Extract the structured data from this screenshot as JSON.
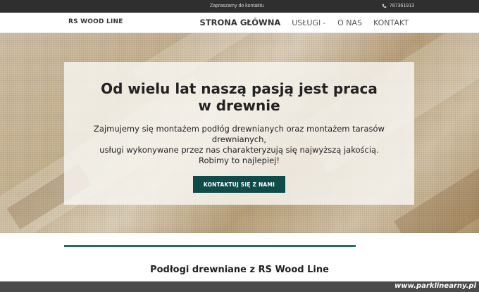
{
  "topbar": {
    "invite_text": "Zapraszamy do kontaktu",
    "phone_icon": "phone-icon",
    "phone": "787361913"
  },
  "navbar": {
    "brand": "RS WOOD LINE",
    "menu": [
      {
        "label": "STRONA GŁÓWNA",
        "active": true
      },
      {
        "label": "USŁUGI",
        "dropdown": true
      },
      {
        "label": "O NAS"
      },
      {
        "label": "KONTAKT"
      }
    ]
  },
  "hero": {
    "title": "Od wielu lat naszą pasją jest praca w drewnie",
    "text_lines": [
      "Zajmujemy się montażem podłóg drewnianych oraz montażem tarasów drewnianych,",
      "usługi wykonywane przez nas charakteryzują się najwyższą jakością.",
      "Robimy to najlepiej!"
    ],
    "cta_label": "KONTAKTUJ SIĘ Z NAMI"
  },
  "section": {
    "title": "Podłogi drewniane z RS Wood Line"
  },
  "watermark": "www.parklinearny.pl",
  "colors": {
    "topbar": "#2f2f2f",
    "accent": "#0f4b48",
    "divider": "#1d6d69"
  }
}
